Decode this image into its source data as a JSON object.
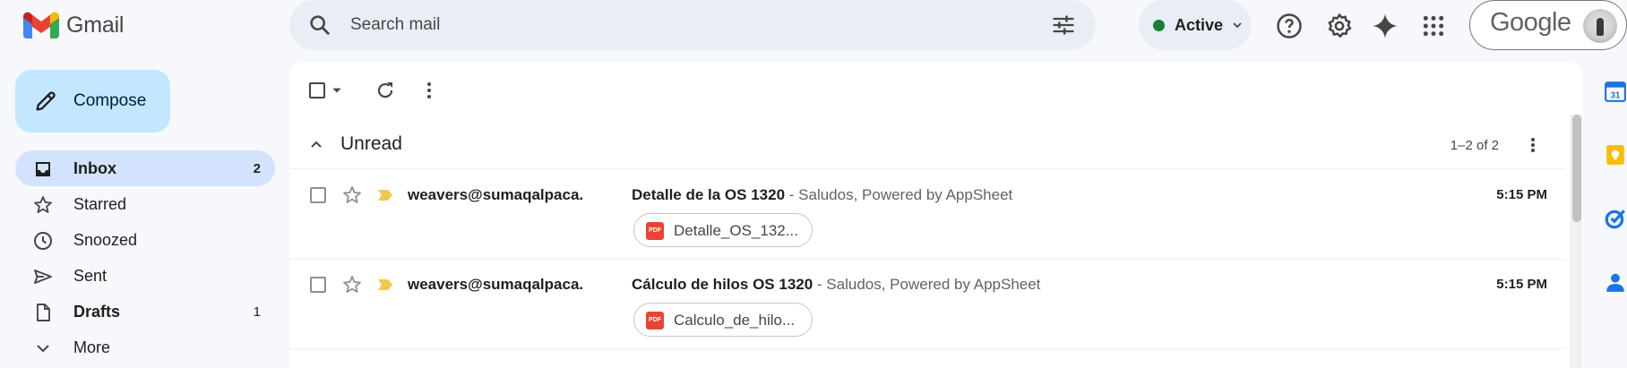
{
  "app": {
    "name": "Gmail"
  },
  "search": {
    "placeholder": "Search mail"
  },
  "status": {
    "label": "Active",
    "color": "#188038"
  },
  "account": {
    "brand": "Google"
  },
  "compose": {
    "label": "Compose"
  },
  "sidebar": {
    "items": [
      {
        "label": "Inbox",
        "count": "2",
        "icon": "inbox-icon",
        "active": true
      },
      {
        "label": "Starred",
        "count": "",
        "icon": "star-icon"
      },
      {
        "label": "Snoozed",
        "count": "",
        "icon": "clock-icon"
      },
      {
        "label": "Sent",
        "count": "",
        "icon": "send-icon"
      },
      {
        "label": "Drafts",
        "count": "1",
        "icon": "draft-icon"
      },
      {
        "label": "More",
        "count": "",
        "icon": "chevron-down-icon"
      }
    ]
  },
  "section": {
    "title": "Unread",
    "range": "1–2 of 2"
  },
  "emails": [
    {
      "sender": "weavers@sumaqalpaca.",
      "subject": "Detalle de la OS 1320",
      "snippet": " - Saludos, Powered by AppSheet",
      "time": "5:15 PM",
      "attachment": "Detalle_OS_132...",
      "attachment_type": "PDF"
    },
    {
      "sender": "weavers@sumaqalpaca.",
      "subject": "Cálculo de hilos OS 1320",
      "snippet": " - Saludos, Powered by AppSheet",
      "time": "5:15 PM",
      "attachment": "Calculo_de_hilo...",
      "attachment_type": "PDF"
    }
  ],
  "side_apps": [
    "calendar-icon",
    "keep-icon",
    "tasks-icon",
    "contacts-icon"
  ],
  "colors": {
    "accent": "#0b57d0",
    "compose_bg": "#c2e7ff",
    "active_nav_bg": "#d3e3fd",
    "important_marker": "#f2c94c"
  }
}
